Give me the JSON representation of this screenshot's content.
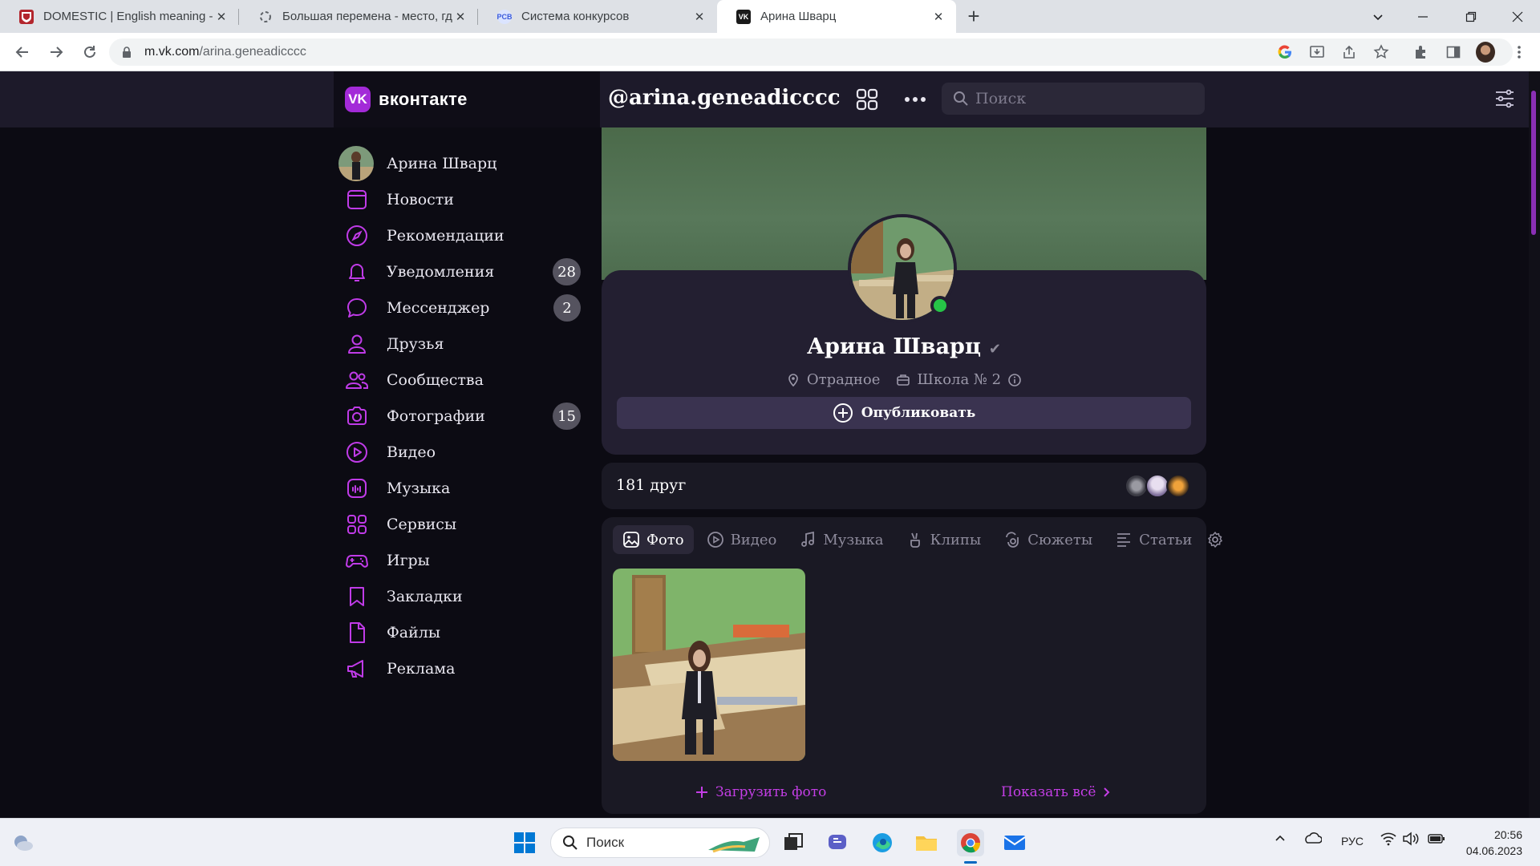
{
  "browser": {
    "tabs": [
      {
        "title": "DOMESTIC | English meaning - C",
        "favicon": "cambridge-icon",
        "color": "#c0392b"
      },
      {
        "title": "Большая перемена - место, где",
        "favicon": "loading-icon",
        "color": "#5f6368"
      },
      {
        "title": "Система конкурсов",
        "favicon": "pcb-icon",
        "color": "#3b5bdb"
      },
      {
        "title": "Арина Шварц",
        "favicon": "vk-icon",
        "color": "#0077ff"
      }
    ],
    "active_tab": 3,
    "url_host": "m.vk.com",
    "url_path": "/arina.geneadicccc"
  },
  "vk": {
    "brand": "вконтакте",
    "handle": "@arina.geneadicccc",
    "search_placeholder": "Поиск",
    "accent": "#a32ad8",
    "sidebar": [
      {
        "label": "Арина Шварц",
        "icon": "avatar",
        "badge": ""
      },
      {
        "label": "Новости",
        "icon": "news-icon",
        "badge": ""
      },
      {
        "label": "Рекомендации",
        "icon": "compass-icon",
        "badge": ""
      },
      {
        "label": "Уведомления",
        "icon": "bell-icon",
        "badge": "28"
      },
      {
        "label": "Мессенджер",
        "icon": "chat-icon",
        "badge": "2"
      },
      {
        "label": "Друзья",
        "icon": "user-icon",
        "badge": ""
      },
      {
        "label": "Сообщества",
        "icon": "users-icon",
        "badge": ""
      },
      {
        "label": "Фотографии",
        "icon": "camera-icon",
        "badge": "15"
      },
      {
        "label": "Видео",
        "icon": "play-icon",
        "badge": ""
      },
      {
        "label": "Музыка",
        "icon": "music-icon",
        "badge": ""
      },
      {
        "label": "Сервисы",
        "icon": "grid-icon",
        "badge": ""
      },
      {
        "label": "Игры",
        "icon": "gamepad-icon",
        "badge": ""
      },
      {
        "label": "Закладки",
        "icon": "bookmark-icon",
        "badge": ""
      },
      {
        "label": "Файлы",
        "icon": "file-icon",
        "badge": ""
      },
      {
        "label": "Реклама",
        "icon": "megaphone-icon",
        "badge": ""
      }
    ],
    "profile": {
      "name": "Арина Шварц",
      "location": "Отрадное",
      "school": "Школа № 2",
      "publish_label": "Опубликовать",
      "friends_count": "181 друг"
    },
    "media_tabs": [
      {
        "label": "Фото",
        "icon": "image-icon"
      },
      {
        "label": "Видео",
        "icon": "play-icon"
      },
      {
        "label": "Музыка",
        "icon": "music-note-icon"
      },
      {
        "label": "Клипы",
        "icon": "clip-icon"
      },
      {
        "label": "Сюжеты",
        "icon": "story-icon"
      },
      {
        "label": "Статьи",
        "icon": "article-icon"
      }
    ],
    "upload_label": "Загрузить фото",
    "show_all_label": "Показать всё"
  },
  "taskbar": {
    "search_placeholder": "Поиск",
    "language": "РУС",
    "time": "20:56",
    "date": "04.06.2023"
  }
}
